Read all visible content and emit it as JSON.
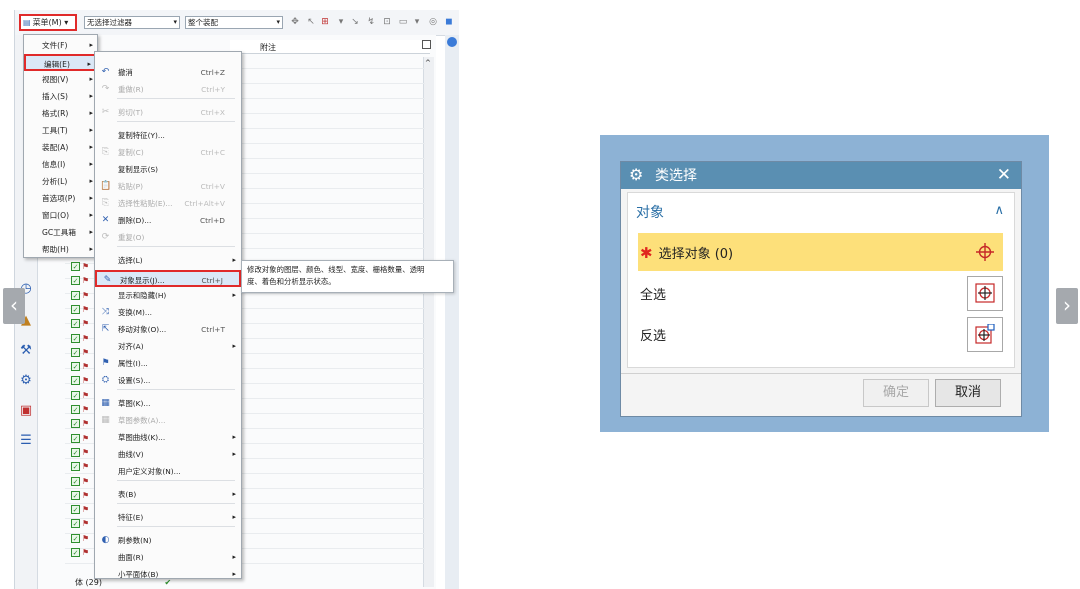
{
  "toolbar": {
    "menu_label": "菜单(M) ▾",
    "filter_value": "无选择过滤器",
    "scope_value": "整个装配"
  },
  "nav": {
    "column_note": "附注",
    "bottom_row": "体 (29)"
  },
  "main_menu": {
    "items": [
      {
        "label": "文件(F)"
      },
      {
        "label": "编辑(E)"
      },
      {
        "label": "视图(V)"
      },
      {
        "label": "插入(S)"
      },
      {
        "label": "格式(R)"
      },
      {
        "label": "工具(T)"
      },
      {
        "label": "装配(A)"
      },
      {
        "label": "信息(I)"
      },
      {
        "label": "分析(L)"
      },
      {
        "label": "首选项(P)"
      },
      {
        "label": "窗口(O)"
      },
      {
        "label": "GC工具箱"
      },
      {
        "label": "帮助(H)"
      }
    ]
  },
  "edit_menu": {
    "items": [
      {
        "label": "撤消",
        "shortcut": "Ctrl+Z"
      },
      {
        "label": "重做(R)",
        "shortcut": "Ctrl+Y"
      },
      {
        "label": "剪切(T)",
        "shortcut": "Ctrl+X"
      },
      {
        "label": "复制特征(Y)...",
        "shortcut": ""
      },
      {
        "label": "复制(C)",
        "shortcut": "Ctrl+C"
      },
      {
        "label": "复制显示(S)",
        "shortcut": ""
      },
      {
        "label": "粘贴(P)",
        "shortcut": "Ctrl+V"
      },
      {
        "label": "选择性粘贴(E)...",
        "shortcut": "Ctrl+Alt+V"
      },
      {
        "label": "删除(D)...",
        "shortcut": "Ctrl+D"
      },
      {
        "label": "重复(O)",
        "shortcut": ""
      },
      {
        "label": "选择(L)",
        "shortcut": ""
      },
      {
        "label": "对象显示(J)...",
        "shortcut": "Ctrl+J"
      },
      {
        "label": "显示和隐藏(H)",
        "shortcut": ""
      },
      {
        "label": "变换(M)...",
        "shortcut": ""
      },
      {
        "label": "移动对象(O)...",
        "shortcut": "Ctrl+T"
      },
      {
        "label": "对齐(A)",
        "shortcut": ""
      },
      {
        "label": "属性(I)...",
        "shortcut": ""
      },
      {
        "label": "设置(S)...",
        "shortcut": ""
      },
      {
        "label": "草图(K)...",
        "shortcut": ""
      },
      {
        "label": "草图参数(A)...",
        "shortcut": ""
      },
      {
        "label": "草图曲线(K)...",
        "shortcut": ""
      },
      {
        "label": "曲线(V)",
        "shortcut": ""
      },
      {
        "label": "用户定义对象(N)...",
        "shortcut": ""
      },
      {
        "label": "表(B)",
        "shortcut": ""
      },
      {
        "label": "特征(E)",
        "shortcut": ""
      },
      {
        "label": "刷参数(N)",
        "shortcut": ""
      },
      {
        "label": "曲面(R)",
        "shortcut": ""
      },
      {
        "label": "小平面体(B)",
        "shortcut": ""
      }
    ]
  },
  "tooltip": {
    "line1": "修改对象的图层、颜色、线型、宽度、栅格数量、透明",
    "line2": "度、着色和分析显示状态。"
  },
  "dialog": {
    "title": "类选择",
    "group_label": "对象",
    "select_object_label": "选择对象 (0)",
    "select_all_label": "全选",
    "invert_label": "反选",
    "ok_label": "确定",
    "cancel_label": "取消"
  },
  "colors": {
    "highlight_border": "#e02a2a",
    "dialog_titlebar": "#5a8fb2",
    "dialog_backdrop": "#8db2d5",
    "select_row": "#fde07a",
    "group_label": "#2a6fa6"
  }
}
